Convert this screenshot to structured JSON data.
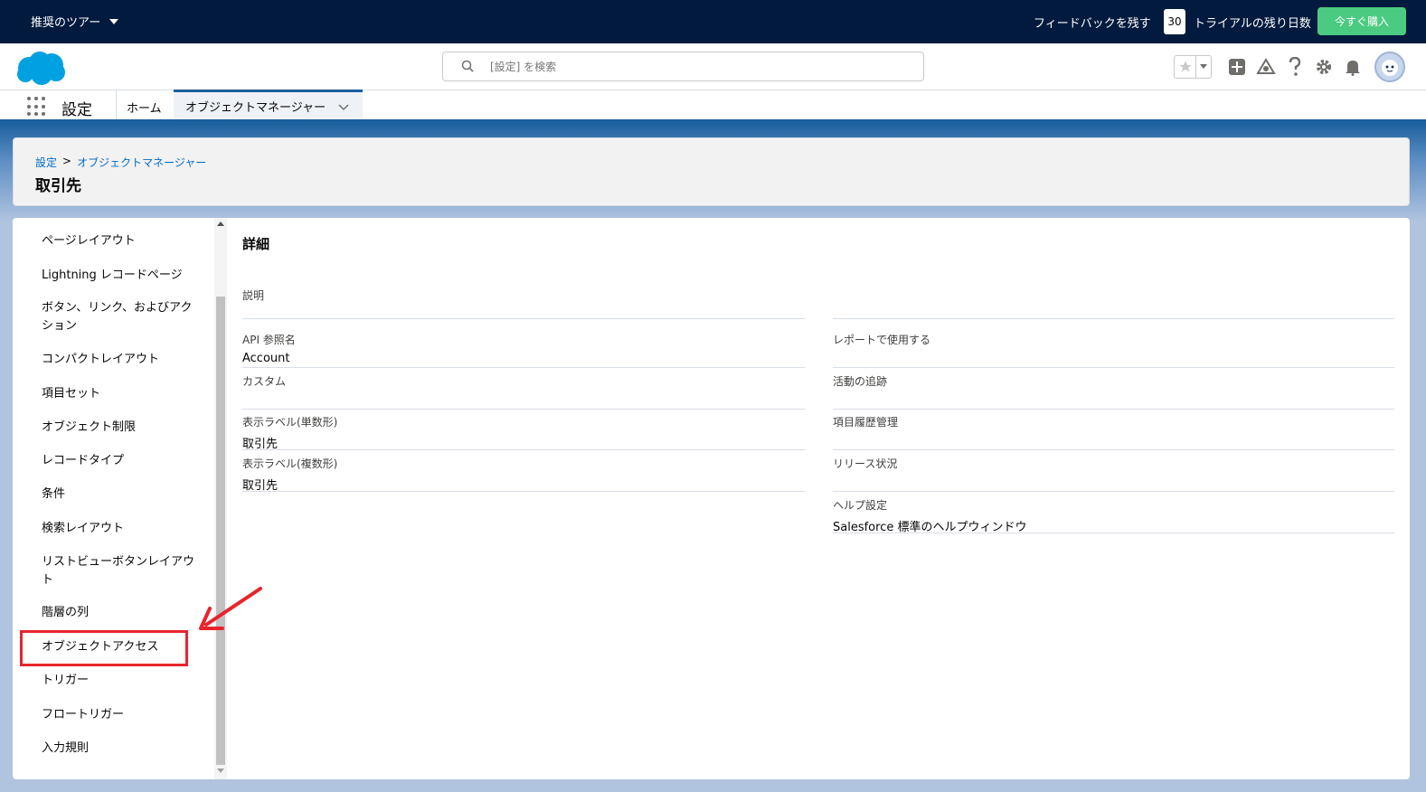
{
  "topbar": {
    "tour_label": "推奨のツアー",
    "feedback_label": "フィードバックを残す",
    "trial_days": "30",
    "trial_text": "トライアルの残り日数",
    "buy_label": "今すぐ購入"
  },
  "header": {
    "search_placeholder": "[設定] を検索"
  },
  "nav": {
    "app_name": "設定",
    "tabs": [
      {
        "label": "ホーム"
      },
      {
        "label": "オブジェクトマネージャー"
      }
    ]
  },
  "page": {
    "breadcrumb": [
      "設定",
      "オブジェクトマネージャー"
    ],
    "breadcrumb_sep": ">",
    "title": "取引先"
  },
  "sidenav": {
    "items": [
      {
        "label": "ページレイアウト"
      },
      {
        "label": "Lightning レコードページ"
      },
      {
        "label": "ボタン、リンク、およびアクション"
      },
      {
        "label": "コンパクトレイアウト"
      },
      {
        "label": "項目セット"
      },
      {
        "label": "オブジェクト制限"
      },
      {
        "label": "レコードタイプ"
      },
      {
        "label": "条件"
      },
      {
        "label": "検索レイアウト"
      },
      {
        "label": "リストビューボタンレイアウト"
      },
      {
        "label": "階層の列"
      },
      {
        "label": "オブジェクトアクセス"
      },
      {
        "label": "トリガー"
      },
      {
        "label": "フロートリガー"
      },
      {
        "label": "入力規則"
      }
    ]
  },
  "detail": {
    "heading": "詳細",
    "left_fields": [
      {
        "label": "説明",
        "value": ""
      },
      {
        "label": "API 参照名",
        "value": "Account"
      },
      {
        "label": "カスタム",
        "value": ""
      },
      {
        "label": "表示ラベル(単数形)",
        "value": "取引先"
      },
      {
        "label": "表示ラベル(複数形)",
        "value": "取引先"
      }
    ],
    "right_fields": [
      {
        "label": "レポートで使用する",
        "value": ""
      },
      {
        "label": "活動の追跡",
        "value": ""
      },
      {
        "label": "項目履歴管理",
        "value": ""
      },
      {
        "label": "リリース状況",
        "value": ""
      },
      {
        "label": "ヘルプ設定",
        "value": "Salesforce 標準のヘルプウィンドウ"
      }
    ]
  },
  "colors": {
    "topbar": "#011a3d",
    "buy_button": "#4bca81",
    "link": "#006dcc",
    "brand_blue": "#1b5f9e",
    "annotation": "#e8232c"
  },
  "icons": [
    "salesforce-cloud-logo",
    "search-icon",
    "star-icon",
    "chevron-down-icon",
    "add-icon",
    "trailhead-icon",
    "help-icon",
    "gear-icon",
    "bell-icon",
    "avatar",
    "waffle-icon",
    "annotation-arrow"
  ]
}
